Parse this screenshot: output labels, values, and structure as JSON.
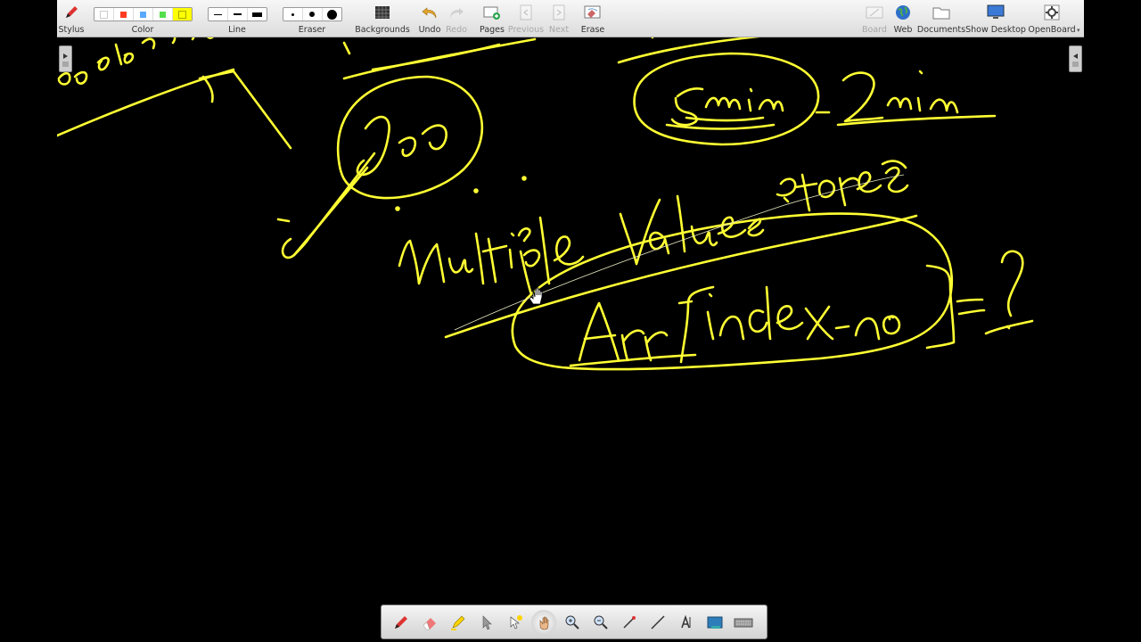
{
  "toolbar": {
    "stylus": "Stylus",
    "color": "Color",
    "line": "Line",
    "eraser": "Eraser",
    "backgrounds": "Backgrounds",
    "undo": "Undo",
    "redo": "Redo",
    "pages": "Pages",
    "previous": "Previous",
    "next": "Next",
    "erase": "Erase",
    "board": "Board",
    "web": "Web",
    "documents": "Documents",
    "show_desktop": "Show Desktop",
    "openboard": "OpenBoard"
  },
  "colors": {
    "ink": "#ffff33",
    "swatches": [
      "#ffffff",
      "#ff3b1f",
      "#5aa9ff",
      "#54e04c",
      "#ffff00"
    ]
  },
  "bottom_tools": [
    "pen-icon",
    "eraser-icon",
    "highlighter-icon",
    "pointer-icon",
    "laser-icon",
    "hand-icon",
    "zoom-in-icon",
    "zoom-out-icon",
    "line-icon",
    "ruler-icon",
    "text-icon",
    "capture-icon",
    "keyboard-icon"
  ]
}
